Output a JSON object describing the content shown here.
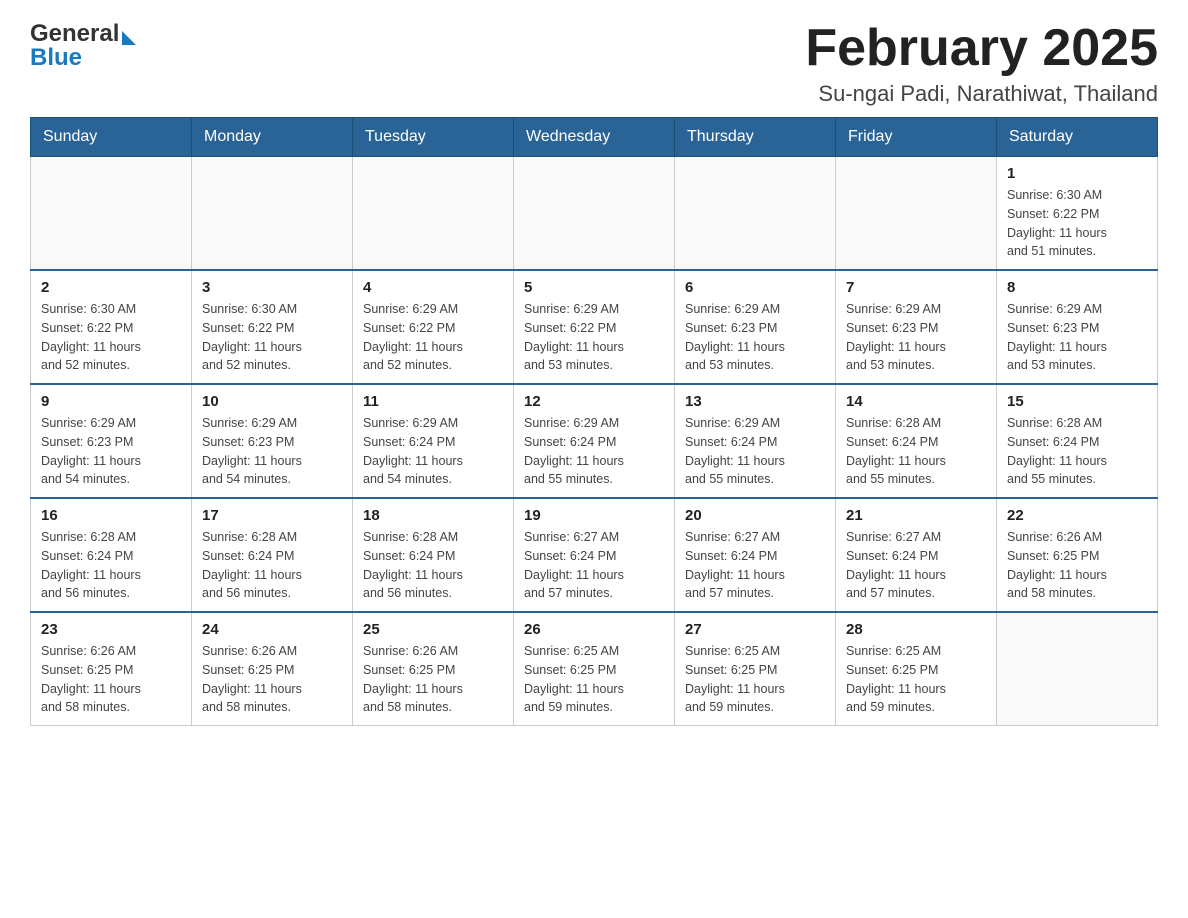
{
  "header": {
    "logo_general": "General",
    "logo_blue": "Blue",
    "month_title": "February 2025",
    "location": "Su-ngai Padi, Narathiwat, Thailand"
  },
  "days_of_week": [
    "Sunday",
    "Monday",
    "Tuesday",
    "Wednesday",
    "Thursday",
    "Friday",
    "Saturday"
  ],
  "weeks": [
    {
      "days": [
        {
          "number": "",
          "info": ""
        },
        {
          "number": "",
          "info": ""
        },
        {
          "number": "",
          "info": ""
        },
        {
          "number": "",
          "info": ""
        },
        {
          "number": "",
          "info": ""
        },
        {
          "number": "",
          "info": ""
        },
        {
          "number": "1",
          "info": "Sunrise: 6:30 AM\nSunset: 6:22 PM\nDaylight: 11 hours\nand 51 minutes."
        }
      ]
    },
    {
      "days": [
        {
          "number": "2",
          "info": "Sunrise: 6:30 AM\nSunset: 6:22 PM\nDaylight: 11 hours\nand 52 minutes."
        },
        {
          "number": "3",
          "info": "Sunrise: 6:30 AM\nSunset: 6:22 PM\nDaylight: 11 hours\nand 52 minutes."
        },
        {
          "number": "4",
          "info": "Sunrise: 6:29 AM\nSunset: 6:22 PM\nDaylight: 11 hours\nand 52 minutes."
        },
        {
          "number": "5",
          "info": "Sunrise: 6:29 AM\nSunset: 6:22 PM\nDaylight: 11 hours\nand 53 minutes."
        },
        {
          "number": "6",
          "info": "Sunrise: 6:29 AM\nSunset: 6:23 PM\nDaylight: 11 hours\nand 53 minutes."
        },
        {
          "number": "7",
          "info": "Sunrise: 6:29 AM\nSunset: 6:23 PM\nDaylight: 11 hours\nand 53 minutes."
        },
        {
          "number": "8",
          "info": "Sunrise: 6:29 AM\nSunset: 6:23 PM\nDaylight: 11 hours\nand 53 minutes."
        }
      ]
    },
    {
      "days": [
        {
          "number": "9",
          "info": "Sunrise: 6:29 AM\nSunset: 6:23 PM\nDaylight: 11 hours\nand 54 minutes."
        },
        {
          "number": "10",
          "info": "Sunrise: 6:29 AM\nSunset: 6:23 PM\nDaylight: 11 hours\nand 54 minutes."
        },
        {
          "number": "11",
          "info": "Sunrise: 6:29 AM\nSunset: 6:24 PM\nDaylight: 11 hours\nand 54 minutes."
        },
        {
          "number": "12",
          "info": "Sunrise: 6:29 AM\nSunset: 6:24 PM\nDaylight: 11 hours\nand 55 minutes."
        },
        {
          "number": "13",
          "info": "Sunrise: 6:29 AM\nSunset: 6:24 PM\nDaylight: 11 hours\nand 55 minutes."
        },
        {
          "number": "14",
          "info": "Sunrise: 6:28 AM\nSunset: 6:24 PM\nDaylight: 11 hours\nand 55 minutes."
        },
        {
          "number": "15",
          "info": "Sunrise: 6:28 AM\nSunset: 6:24 PM\nDaylight: 11 hours\nand 55 minutes."
        }
      ]
    },
    {
      "days": [
        {
          "number": "16",
          "info": "Sunrise: 6:28 AM\nSunset: 6:24 PM\nDaylight: 11 hours\nand 56 minutes."
        },
        {
          "number": "17",
          "info": "Sunrise: 6:28 AM\nSunset: 6:24 PM\nDaylight: 11 hours\nand 56 minutes."
        },
        {
          "number": "18",
          "info": "Sunrise: 6:28 AM\nSunset: 6:24 PM\nDaylight: 11 hours\nand 56 minutes."
        },
        {
          "number": "19",
          "info": "Sunrise: 6:27 AM\nSunset: 6:24 PM\nDaylight: 11 hours\nand 57 minutes."
        },
        {
          "number": "20",
          "info": "Sunrise: 6:27 AM\nSunset: 6:24 PM\nDaylight: 11 hours\nand 57 minutes."
        },
        {
          "number": "21",
          "info": "Sunrise: 6:27 AM\nSunset: 6:24 PM\nDaylight: 11 hours\nand 57 minutes."
        },
        {
          "number": "22",
          "info": "Sunrise: 6:26 AM\nSunset: 6:25 PM\nDaylight: 11 hours\nand 58 minutes."
        }
      ]
    },
    {
      "days": [
        {
          "number": "23",
          "info": "Sunrise: 6:26 AM\nSunset: 6:25 PM\nDaylight: 11 hours\nand 58 minutes."
        },
        {
          "number": "24",
          "info": "Sunrise: 6:26 AM\nSunset: 6:25 PM\nDaylight: 11 hours\nand 58 minutes."
        },
        {
          "number": "25",
          "info": "Sunrise: 6:26 AM\nSunset: 6:25 PM\nDaylight: 11 hours\nand 58 minutes."
        },
        {
          "number": "26",
          "info": "Sunrise: 6:25 AM\nSunset: 6:25 PM\nDaylight: 11 hours\nand 59 minutes."
        },
        {
          "number": "27",
          "info": "Sunrise: 6:25 AM\nSunset: 6:25 PM\nDaylight: 11 hours\nand 59 minutes."
        },
        {
          "number": "28",
          "info": "Sunrise: 6:25 AM\nSunset: 6:25 PM\nDaylight: 11 hours\nand 59 minutes."
        },
        {
          "number": "",
          "info": ""
        }
      ]
    }
  ]
}
